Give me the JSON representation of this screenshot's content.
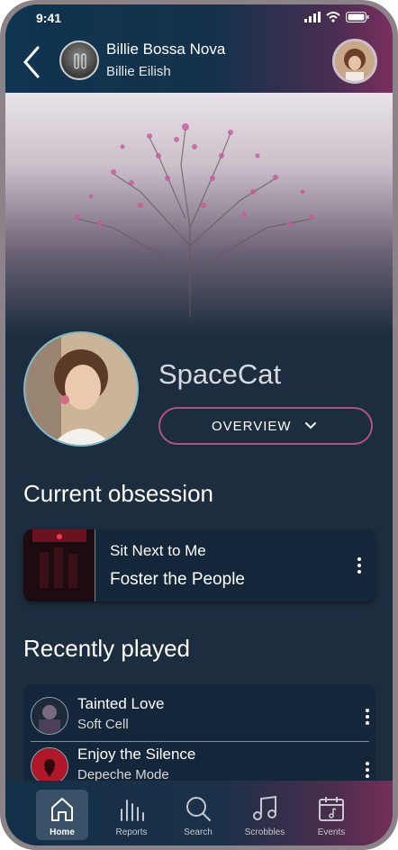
{
  "status_bar": {
    "time": "9:41"
  },
  "now_playing": {
    "title": "Billie Bossa Nova",
    "artist": "Billie Eilish"
  },
  "profile": {
    "username": "SpaceCat",
    "overview_label": "OVERVIEW"
  },
  "current_obsession": {
    "heading": "Current obsession",
    "track": "Sit Next to Me",
    "artist": "Foster the People"
  },
  "recently_played": {
    "heading": "Recently played",
    "items": [
      {
        "title": "Tainted Love",
        "artist": "Soft Cell"
      },
      {
        "title": "Enjoy the Silence",
        "artist": "Depeche Mode"
      }
    ]
  },
  "nav": {
    "items": [
      {
        "label": "Home",
        "icon": "home-icon",
        "active": true
      },
      {
        "label": "Reports",
        "icon": "bars-icon"
      },
      {
        "label": "Search",
        "icon": "search-icon"
      },
      {
        "label": "Scrobbles",
        "icon": "music-note-icon"
      },
      {
        "label": "Events",
        "icon": "calendar-icon"
      }
    ]
  },
  "colors": {
    "accent_pink": "#b0508a",
    "background": "#1b2d3e",
    "teal": "#4aa0aa"
  }
}
